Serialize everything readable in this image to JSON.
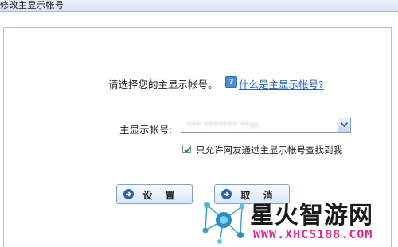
{
  "window": {
    "title": "修改主显示帐号"
  },
  "dialog": {
    "prompt": "请选择您的主显示帐号。",
    "help_icon_glyph": "?",
    "help_link": "什么是主显示帐号?",
    "account_label": "主显示帐号:",
    "account_value": "*** ******* **m",
    "checkbox_checked": true,
    "checkbox_label": "只允许网友通过主显示帐号查找到我"
  },
  "buttons": {
    "set_label": "设 置",
    "cancel_label": "取 消"
  },
  "watermark": {
    "brand": "星火智游网",
    "url": "WWW.XHCS188.COM"
  },
  "colors": {
    "link": "#1f5fb8",
    "accent": "#2f63b0",
    "url": "#e0298b"
  }
}
